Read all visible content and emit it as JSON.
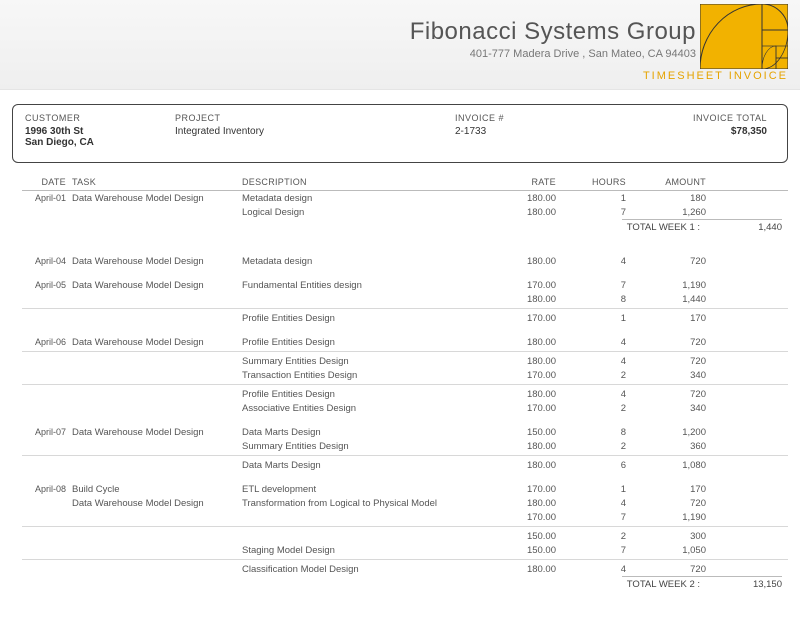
{
  "company": {
    "name": "Fibonacci Systems Group",
    "address": "401-777 Madera Drive , San Mateo, CA  94403"
  },
  "doc_type": "TIMESHEET INVOICE",
  "info": {
    "customer_label": "CUSTOMER",
    "customer_line1": "1996 30th St",
    "customer_line2": "San Diego, CA",
    "project_label": "PROJECT",
    "project_value": "Integrated Inventory",
    "invoice_label": "INVOICE #",
    "invoice_value": "2-1733",
    "total_label": "INVOICE TOTAL",
    "total_value": "$78,350"
  },
  "columns": {
    "date": "DATE",
    "task": "TASK",
    "desc": "DESCRIPTION",
    "rate": "RATE",
    "hours": "HOURS",
    "amount": "AMOUNT"
  },
  "rows": [
    {
      "date": "April-01",
      "task": "Data Warehouse Model Design",
      "desc": "Metadata design",
      "rate": "180.00",
      "hours": "1",
      "amount": "180"
    },
    {
      "date": "",
      "task": "",
      "desc": "Logical Design",
      "rate": "180.00",
      "hours": "7",
      "amount": "1,260"
    }
  ],
  "week1": {
    "label": "TOTAL WEEK 1 :",
    "value": "1,440"
  },
  "rows2": [
    {
      "date": "April-04",
      "task": "Data Warehouse Model Design",
      "desc": "Metadata design",
      "rate": "180.00",
      "hours": "4",
      "amount": "720",
      "gapBefore": true
    },
    {
      "date": "April-05",
      "task": "Data Warehouse Model Design",
      "desc": "Fundamental Entities design",
      "rate": "170.00",
      "hours": "7",
      "amount": "1,190",
      "gapBefore": true
    },
    {
      "date": "",
      "task": "",
      "desc": "",
      "rate": "180.00",
      "hours": "8",
      "amount": "1,440"
    },
    {
      "date": "",
      "task": "",
      "desc": "Profile Entities Design",
      "rate": "170.00",
      "hours": "1",
      "amount": "170",
      "sepBefore": true
    },
    {
      "date": "April-06",
      "task": "Data Warehouse Model Design",
      "desc": "Profile Entities Design",
      "rate": "180.00",
      "hours": "4",
      "amount": "720",
      "gapBefore": true
    },
    {
      "date": "",
      "task": "",
      "desc": "Summary Entities Design",
      "rate": "180.00",
      "hours": "4",
      "amount": "720",
      "sepBefore": true
    },
    {
      "date": "",
      "task": "",
      "desc": "Transaction Entities Design",
      "rate": "170.00",
      "hours": "2",
      "amount": "340"
    },
    {
      "date": "",
      "task": "",
      "desc": "Profile Entities Design",
      "rate": "180.00",
      "hours": "4",
      "amount": "720",
      "sepBefore": true
    },
    {
      "date": "",
      "task": "",
      "desc": "Associative Entities Design",
      "rate": "170.00",
      "hours": "2",
      "amount": "340"
    },
    {
      "date": "April-07",
      "task": "Data Warehouse Model Design",
      "desc": "Data Marts Design",
      "rate": "150.00",
      "hours": "8",
      "amount": "1,200",
      "gapBefore": true
    },
    {
      "date": "",
      "task": "",
      "desc": "Summary Entities Design",
      "rate": "180.00",
      "hours": "2",
      "amount": "360"
    },
    {
      "date": "",
      "task": "",
      "desc": "Data Marts Design",
      "rate": "180.00",
      "hours": "6",
      "amount": "1,080",
      "sepBefore": true
    },
    {
      "date": "April-08",
      "task": "Build Cycle",
      "desc": "ETL development",
      "rate": "170.00",
      "hours": "1",
      "amount": "170",
      "gapBefore": true
    },
    {
      "date": "",
      "task": "Data Warehouse Model Design",
      "desc": "Transformation from Logical to Physical Model",
      "rate": "180.00",
      "hours": "4",
      "amount": "720"
    },
    {
      "date": "",
      "task": "",
      "desc": "",
      "rate": "170.00",
      "hours": "7",
      "amount": "1,190"
    },
    {
      "date": "",
      "task": "",
      "desc": "",
      "rate": "150.00",
      "hours": "2",
      "amount": "300",
      "sepBefore": true
    },
    {
      "date": "",
      "task": "",
      "desc": "Staging Model Design",
      "rate": "150.00",
      "hours": "7",
      "amount": "1,050"
    },
    {
      "date": "",
      "task": "",
      "desc": "Classification Model Design",
      "rate": "180.00",
      "hours": "4",
      "amount": "720",
      "sepBefore": true
    }
  ],
  "week2": {
    "label": "TOTAL WEEK 2 :",
    "value": "13,150"
  }
}
